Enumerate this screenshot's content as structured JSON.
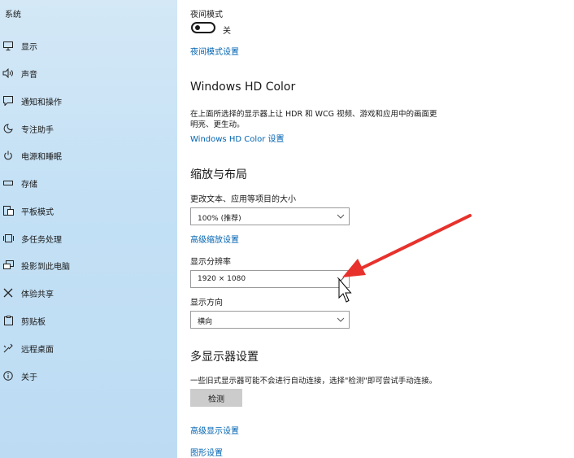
{
  "sidebar": {
    "title": "系统",
    "items": [
      {
        "label": "显示",
        "icon": "display-icon"
      },
      {
        "label": "声音",
        "icon": "speaker-icon"
      },
      {
        "label": "通知和操作",
        "icon": "notification-icon"
      },
      {
        "label": "专注助手",
        "icon": "moon-icon"
      },
      {
        "label": "电源和睡眠",
        "icon": "power-icon"
      },
      {
        "label": "存储",
        "icon": "storage-icon"
      },
      {
        "label": "平板模式",
        "icon": "tablet-mode-icon"
      },
      {
        "label": "多任务处理",
        "icon": "multitasking-icon"
      },
      {
        "label": "投影到此电脑",
        "icon": "projecting-icon"
      },
      {
        "label": "体验共享",
        "icon": "shared-experiences-icon"
      },
      {
        "label": "剪贴板",
        "icon": "clipboard-icon"
      },
      {
        "label": "远程桌面",
        "icon": "remote-desktop-icon"
      },
      {
        "label": "关于",
        "icon": "info-icon"
      }
    ]
  },
  "night_light": {
    "label": "夜间模式",
    "state": "关",
    "settings_link": "夜间模式设置"
  },
  "hd_color": {
    "heading": "Windows HD Color",
    "description_line1": "在上面所选择的显示器上让 HDR 和 WCG 视频、游戏和应用中的画面更",
    "description_line2": "明亮、更生动。",
    "link": "Windows HD Color 设置"
  },
  "scale_layout": {
    "heading": "缩放与布局",
    "scale_label": "更改文本、应用等项目的大小",
    "scale_value": "100% (推荐)",
    "advanced_scaling_link": "高级缩放设置",
    "resolution_label": "显示分辨率",
    "resolution_value": "1920 × 1080",
    "orientation_label": "显示方向",
    "orientation_value": "横向"
  },
  "multi_display": {
    "heading": "多显示器设置",
    "description": "一些旧式显示器可能不会进行自动连接，选择\"检测\"即可尝试手动连接。",
    "detect_button": "检测",
    "advanced_display_link": "高级显示设置",
    "graphics_link": "图形设置"
  },
  "colors": {
    "link": "#0063b1",
    "annotation_arrow": "#e8312c",
    "sidebar": "#c3e0f5"
  }
}
